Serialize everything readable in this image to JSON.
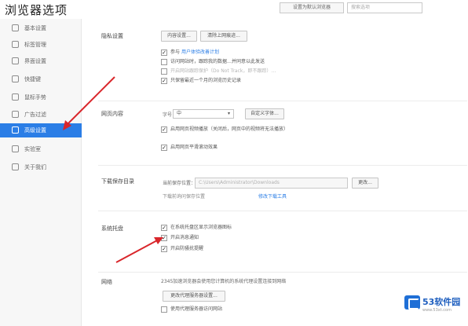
{
  "app": {
    "title": "浏览器选项",
    "top_button": "设置为默认浏览器",
    "search_placeholder": "搜索选项"
  },
  "sidebar": {
    "items": [
      {
        "label": "基本设置",
        "icon": "gear-icon"
      },
      {
        "label": "标签管理",
        "icon": "tab-icon"
      },
      {
        "label": "界面设置",
        "icon": "layout-icon"
      },
      {
        "label": "快捷键",
        "icon": "keyboard-icon"
      },
      {
        "label": "鼠标手势",
        "icon": "mouse-icon"
      },
      {
        "label": "广告过滤",
        "icon": "shield-icon"
      },
      {
        "label": "高级设置",
        "icon": "advanced-icon",
        "active": true
      },
      {
        "label": "实验室",
        "icon": "lab-icon"
      },
      {
        "label": "关于我们",
        "icon": "info-icon"
      }
    ]
  },
  "privacy": {
    "title": "隐私设置",
    "btn_content": "内容设置...",
    "btn_clear": "清除上网痕迹...",
    "options": [
      {
        "label": "参与",
        "link": "用户体验改善计划",
        "checked": true
      },
      {
        "label": "访问网站时，跟踪我的数据…并同意以此发送",
        "checked": false
      },
      {
        "label": "开启网站跟踪保护（Do Not Track，即不跟踪）…",
        "checked": false
      },
      {
        "label": "只保留最近一个月的浏览历史记录",
        "checked": true
      }
    ]
  },
  "web_content": {
    "title": "网页内容",
    "font_size_label": "字号",
    "font_size_value": "中",
    "btn_font": "自定义字体...",
    "options": [
      {
        "label": "启用网页视频播放（关闭后，网页中的视频将无法播放）",
        "checked": true
      },
      {
        "label": "启用网页平滑滚动效果",
        "checked": true
      }
    ]
  },
  "download": {
    "title": "下载保存目录",
    "path_label": "当前保存位置：",
    "path_value": "C:\\Users\\Administrator\\Downloads",
    "btn_change": "更改...",
    "hint": "下载前询问保存位置",
    "hint_link": "修改下载工具"
  },
  "tray": {
    "title": "系统托盘",
    "options": [
      {
        "label": "在系统托盘区显示浏览器图标",
        "checked": true
      },
      {
        "label": "开启消息通知",
        "checked": true
      },
      {
        "label": "开启防骚扰提醒",
        "checked": true
      }
    ]
  },
  "network": {
    "title": "网络",
    "desc": "2345加速浏览器会使用您计算机的系统代理设置连接到网络",
    "btn_proxy": "更改代理服务器设置...",
    "options": [
      {
        "label": "使用代理服务器访问网站",
        "checked": false
      }
    ]
  },
  "watermark": {
    "brand": "53软件园",
    "url": "www.53xt.com"
  },
  "colors": {
    "accent": "#2b7ee6",
    "arrow": "#d9262b"
  }
}
